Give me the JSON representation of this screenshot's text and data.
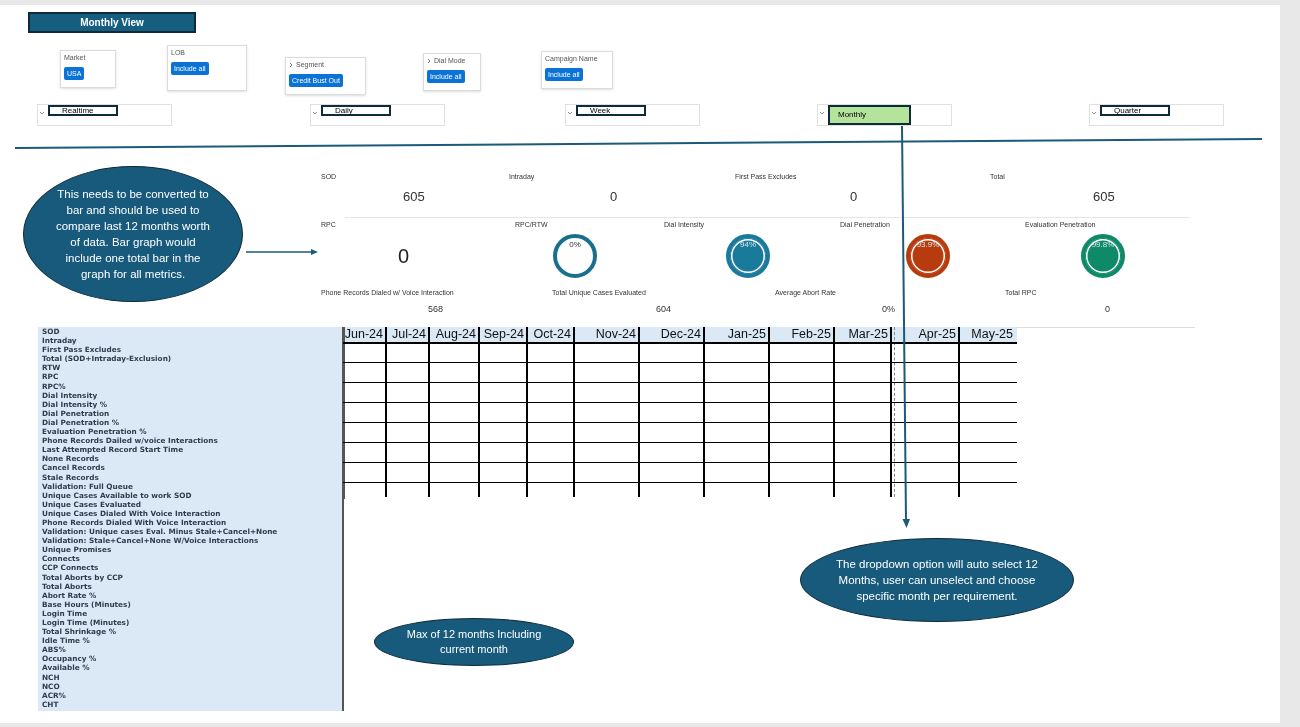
{
  "view_button": "Monthly View",
  "filters": [
    {
      "label": "Market",
      "value": "USA",
      "expandable": false
    },
    {
      "label": "LOB",
      "value": "Include all",
      "expandable": false
    },
    {
      "label": "Segment",
      "value": "Credit Bust Out",
      "expandable": true
    },
    {
      "label": "Dial Mode",
      "value": "Include all",
      "expandable": true
    },
    {
      "label": "Campaign Name",
      "value": "Include all",
      "expandable": false
    }
  ],
  "periods": [
    {
      "label": "Realtime",
      "selected": false
    },
    {
      "label": "Daily",
      "selected": false
    },
    {
      "label": "Week",
      "selected": false
    },
    {
      "label": "Monthly",
      "selected": true
    },
    {
      "label": "Quarter",
      "selected": false
    }
  ],
  "summary": [
    {
      "kind": "number",
      "label": "SOD",
      "value": "605"
    },
    {
      "kind": "number",
      "label": "Intraday",
      "value": "0"
    },
    {
      "kind": "number",
      "label": "First Pass Excludes",
      "value": "0"
    },
    {
      "kind": "number",
      "label": "Total",
      "value": "605"
    },
    {
      "kind": "big",
      "label": "RPC",
      "value": "0"
    },
    {
      "kind": "ring",
      "label": "RPC/RTW",
      "value": "0%",
      "color": "#1a6f8f"
    },
    {
      "kind": "gauge",
      "label": "Dial Intensity",
      "value": "94%",
      "color": "#1a7a9c"
    },
    {
      "kind": "gauge",
      "label": "Dial Penetration",
      "value": "93.9%",
      "color": "#b83b0e"
    },
    {
      "kind": "gauge",
      "label": "Evaluation Penetration",
      "value": "99.8%",
      "color": "#0f8a68"
    },
    {
      "kind": "small",
      "label": "Phone Records Dialed w/ Voice Interaction",
      "value": "568"
    },
    {
      "kind": "small",
      "label": "Total Unique Cases Evaluated",
      "value": "604"
    },
    {
      "kind": "small",
      "label": "Average Abort Rate",
      "value": "0%"
    },
    {
      "kind": "small",
      "label": "Total RPC",
      "value": "0"
    }
  ],
  "metrics_list": [
    "SOD",
    "Intraday",
    "First Pass Excludes",
    "Total (SOD+Intraday-Exclusion)",
    "RTW",
    "RPC",
    "RPC%",
    "Dial Intensity",
    "Dial Intensity %",
    "Dial Penetration",
    "Dial Penetration %",
    "Evaluation Penetration %",
    "Phone Records Dailed w/voice Interactions",
    "Last Attempted Record Start Time",
    "None Records",
    "Cancel Records",
    "Stale Records",
    "Validation: Full Queue",
    "Unique Cases Available to work SOD",
    "Unique Cases Evaluated",
    "Unique Cases Dialed With Voice Interaction",
    "Phone Records Dialed With Voice Interaction",
    "Validation: Unique cases Eval. Minus Stale+Cancel+None",
    "Validation: Stale+Cancel+None W/Voice Interactions",
    "Unique Promises",
    "Connects",
    "CCP Connects",
    "Total Aborts by CCP",
    "Total Aborts",
    "Abort Rate  %",
    "Base Hours (Minutes)",
    "Login Time",
    "Login Time (Minutes)",
    "Total Shrinkage %",
    "Idle Time %",
    "ABS%",
    "Occupancy %",
    "Available %",
    "NCH",
    "NCO",
    "ACR%",
    "CHT"
  ],
  "table": {
    "columns": [
      "Jun-24",
      "Jul-24",
      "Aug-24",
      "Sep-24",
      "Oct-24",
      "Nov-24",
      "Dec-24",
      "Jan-25",
      "Feb-25",
      "Mar-25",
      "Apr-25",
      "May-25"
    ]
  },
  "notes": [
    "This needs to be converted to bar and should be used to compare last 12 months worth of data. Bar graph would include one total bar in the graph for all metrics.",
    "The dropdown option will auto select 12 Months, user can unselect and choose specific month per requirement.",
    "Max of 12 months Including current month"
  ]
}
